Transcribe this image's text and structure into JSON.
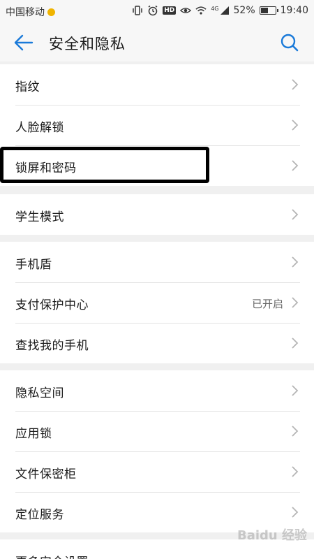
{
  "status_bar": {
    "carrier": "中国移动",
    "network": "4G",
    "battery": "52%",
    "battery_level": 0.52,
    "time": "19:40"
  },
  "header": {
    "title": "安全和隐私",
    "back_icon": "arrow-left-icon",
    "search_icon": "search-icon"
  },
  "groups": [
    {
      "items": [
        {
          "label": "指纹"
        },
        {
          "label": "人脸解锁"
        },
        {
          "label": "锁屏和密码"
        }
      ]
    },
    {
      "items": [
        {
          "label": "学生模式"
        }
      ]
    },
    {
      "items": [
        {
          "label": "手机盾"
        },
        {
          "label": "支付保护中心",
          "value": "已开启"
        },
        {
          "label": "查找我的手机"
        }
      ]
    },
    {
      "items": [
        {
          "label": "隐私空间"
        },
        {
          "label": "应用锁"
        },
        {
          "label": "文件保密柜"
        },
        {
          "label": "定位服务"
        }
      ]
    },
    {
      "items": [
        {
          "label": "更多安全设置"
        }
      ]
    }
  ],
  "watermark": "Baidu 经验",
  "colors": {
    "accent": "#1a7ad9",
    "highlight_border": "#000000"
  }
}
